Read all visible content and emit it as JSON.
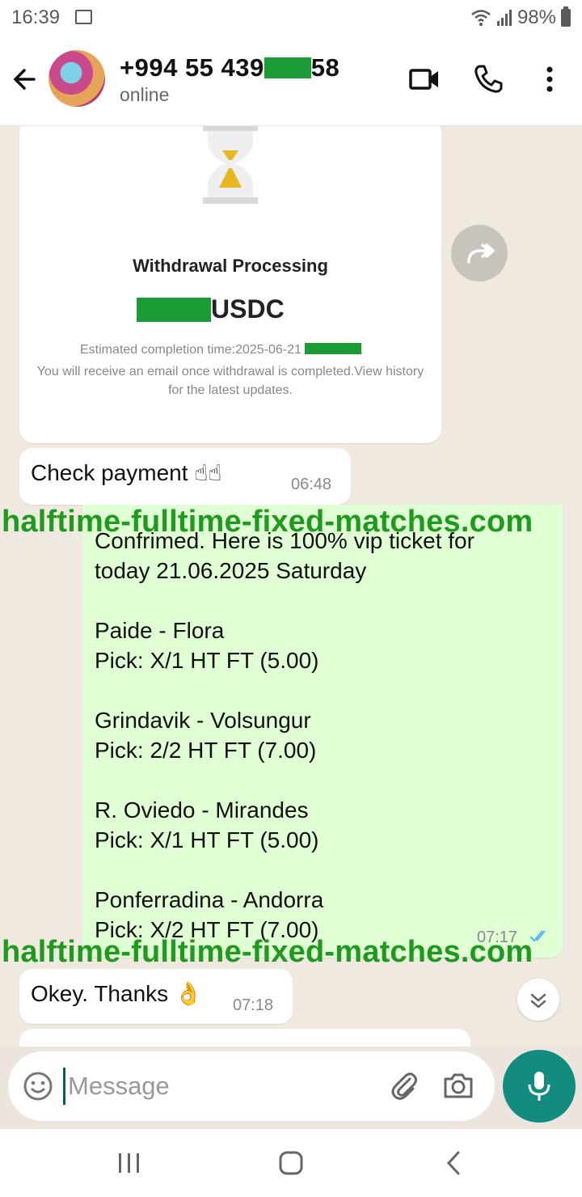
{
  "status_bar": {
    "time": "16:39",
    "battery": "98%"
  },
  "header": {
    "contact_prefix": "+994 55 439",
    "contact_suffix": "58",
    "status": "online"
  },
  "image_message": {
    "title": "Withdrawal Processing",
    "amount_suffix": "USDC",
    "estimate": "Estimated completion time:2025-06-21",
    "note": "You will receive an email once withdrawal is completed.View history for the latest updates."
  },
  "messages": {
    "check_payment": {
      "text": "Check payment ☝☝",
      "time": "06:48"
    },
    "ticket": {
      "lines": [
        "Confrimed. Here is 100% vip ticket for",
        "today 21.06.2025 Saturday",
        "",
        "Paide - Flora",
        "Pick: X/1 HT FT (5.00)",
        "",
        "Grindavik - Volsungur",
        "Pick: 2/2 HT FT (7.00)",
        "",
        "R. Oviedo - Mirandes",
        "Pick: X/1 HT FT (5.00)",
        "",
        "Ponferradina - Andorra",
        "Pick: X/2 HT FT (7.00)"
      ],
      "time": "07:17"
    },
    "okey": {
      "text": "Okey. Thanks 👌",
      "time": "07:18"
    }
  },
  "watermark": "halftime-fulltime-fixed-matches.com",
  "input": {
    "placeholder": "Message"
  },
  "colors": {
    "header_bg": "#ffffff",
    "outgoing_bubble": "#e1ffd4",
    "accent": "#128c7e",
    "redaction": "#1a9b33",
    "watermark": "#1f9a1f"
  }
}
